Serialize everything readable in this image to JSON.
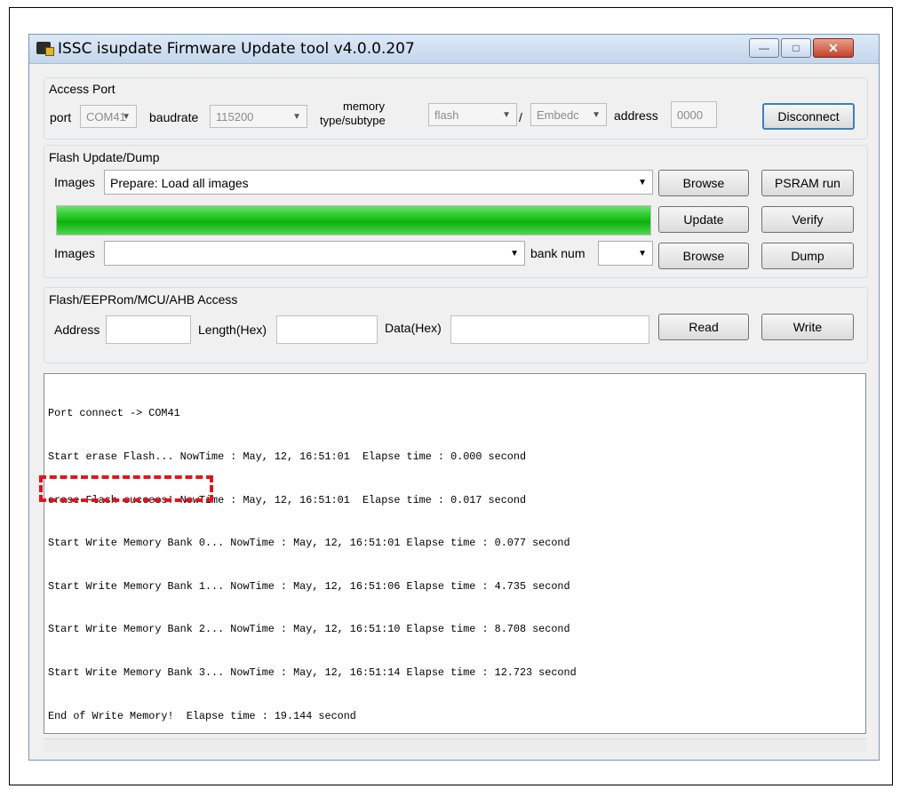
{
  "window": {
    "title": "ISSC isupdate Firmware Update tool  v4.0.0.207",
    "min_glyph": "—",
    "max_glyph": "□",
    "close_glyph": "✕"
  },
  "access_port": {
    "title": "Access Port",
    "port_label": "port",
    "port_value": "COM41",
    "baudrate_label": "baudrate",
    "baudrate_value": "115200",
    "memory_label_1": "memory",
    "memory_label_2": "type/subtype",
    "memory_type": "flash",
    "slash": "/",
    "memory_subtype": "Embedc",
    "address_label": "address",
    "address_value": "0000",
    "disconnect": "Disconnect"
  },
  "flash_update": {
    "title": "Flash Update/Dump",
    "images_label": "Images",
    "images_value": "Prepare: Load all images",
    "browse": "Browse",
    "psram_run": "PSRAM run",
    "progress": 1.0,
    "update": "Update",
    "verify": "Verify",
    "images2_label": "Images",
    "images2_value": "",
    "bank_num_label": "bank num",
    "bank_num_value": "",
    "browse2": "Browse",
    "dump": "Dump"
  },
  "access": {
    "title": "Flash/EEPRom/MCU/AHB Access",
    "address_label": "Address",
    "length_label": "Length(Hex)",
    "data_label": "Data(Hex)",
    "read": "Read",
    "write": "Write"
  },
  "log": {
    "lines": [
      "Port connect -> COM41",
      "Start erase Flash... NowTime : May, 12, 16:51:01  Elapse time : 0.000 second",
      "erase Flash success! NowTime : May, 12, 16:51:01  Elapse time : 0.017 second",
      "Start Write Memory Bank 0... NowTime : May, 12, 16:51:01 Elapse time : 0.077 second",
      "Start Write Memory Bank 1... NowTime : May, 12, 16:51:06 Elapse time : 4.735 second",
      "Start Write Memory Bank 2... NowTime : May, 12, 16:51:10 Elapse time : 8.708 second",
      "Start Write Memory Bank 3... NowTime : May, 12, 16:51:14 Elapse time : 12.723 second",
      "End of Write Memory!  Elapse time : 19.144 second"
    ]
  },
  "colors": {
    "progress_green": "#16c216",
    "highlight_red": "#e4141c"
  }
}
